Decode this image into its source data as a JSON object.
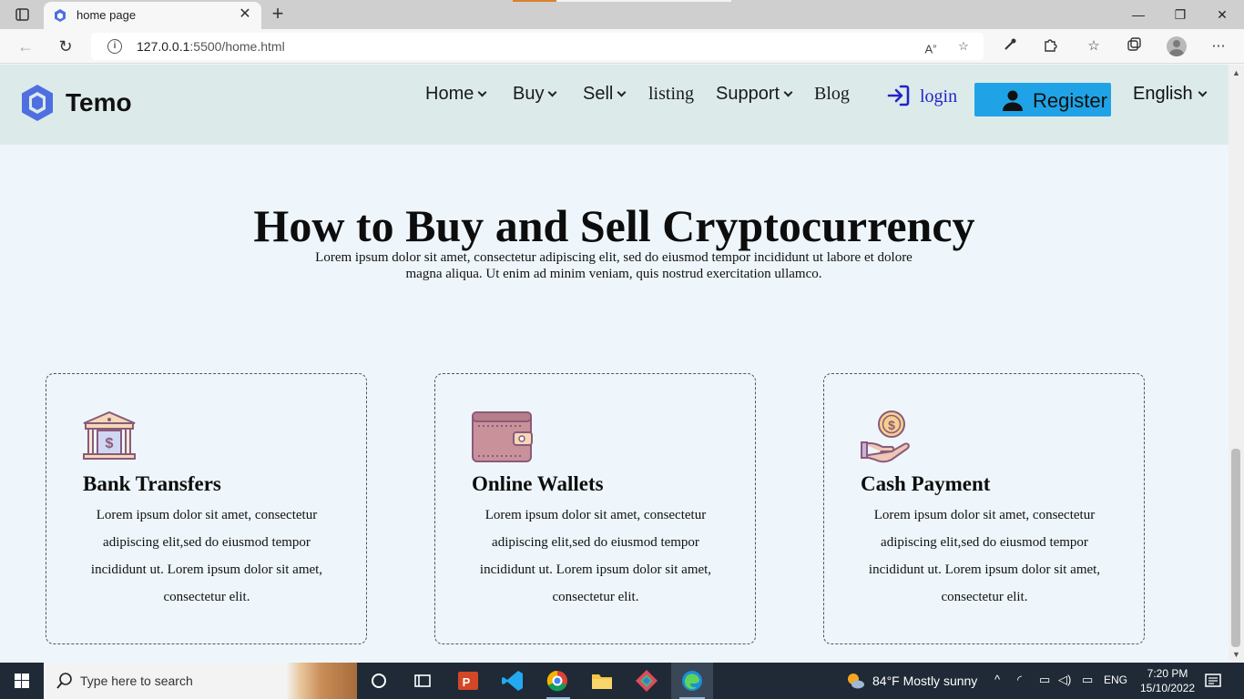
{
  "browser": {
    "tab_title": "home page",
    "url_host": "127.0.0.1",
    "url_rest": ":5500/home.html"
  },
  "site": {
    "logo_text": "Temo",
    "nav": {
      "home": "Home",
      "buy": "Buy",
      "sell": "Sell",
      "listing": "listing",
      "support": "Support",
      "blog": "Blog"
    },
    "login_label": "login",
    "register_label": "Register",
    "language": "English"
  },
  "hero": {
    "title": "How to Buy and Sell Cryptocurrency",
    "subtitle": "Lorem ipsum dolor sit amet, consectetur adipiscing elit, sed do eiusmod tempor incididunt ut labore et dolore magna aliqua. Ut enim ad minim veniam, quis nostrud exercitation ullamco."
  },
  "cards": [
    {
      "icon": "bank-icon",
      "title": "Bank Transfers",
      "text": "Lorem ipsum dolor sit amet, consectetur adipiscing elit,sed do eiusmod tempor incididunt ut. Lorem ipsum dolor sit amet, consectetur elit."
    },
    {
      "icon": "wallet-icon",
      "title": "Online Wallets",
      "text": "Lorem ipsum dolor sit amet, consectetur adipiscing elit,sed do eiusmod tempor incididunt ut. Lorem ipsum dolor sit amet, consectetur elit."
    },
    {
      "icon": "cash-payment-icon",
      "title": "Cash Payment",
      "text": "Lorem ipsum dolor sit amet, consectetur adipiscing elit,sed do eiusmod tempor incididunt ut. Lorem ipsum dolor sit amet, consectetur elit."
    }
  ],
  "taskbar": {
    "search_placeholder": "Type here to search",
    "weather": "84°F  Mostly sunny",
    "language": "ENG",
    "time": "7:20 PM",
    "date": "15/10/2022"
  },
  "colors": {
    "accent": "#1fa3e6",
    "logo": "#4f6fe0",
    "login": "#2323c8",
    "header_bg": "#dcebea",
    "page_bg": "#eef6fb"
  }
}
